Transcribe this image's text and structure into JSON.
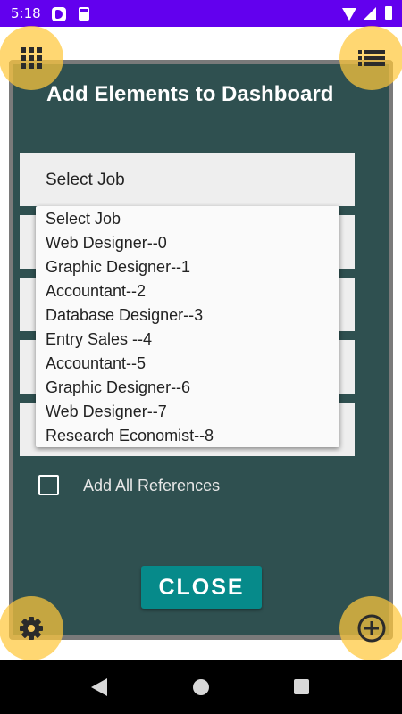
{
  "status_bar": {
    "time": "5:18",
    "icons": [
      "app-notification-icon",
      "sd-card-icon",
      "wifi-icon",
      "cell-signal-icon",
      "battery-icon"
    ]
  },
  "dialog": {
    "title": "Add Elements to Dashboard",
    "select_rows": [
      {
        "value": "Select Job"
      },
      {
        "value": ""
      },
      {
        "value": ""
      },
      {
        "value": ""
      },
      {
        "value": ""
      }
    ],
    "dropdown_options": [
      "Select Job",
      "Web Designer--0",
      "Graphic Designer--1",
      "Accountant--2",
      "Database Designer--3",
      "Entry Sales --4",
      "Accountant--5",
      "Graphic Designer--6",
      "Web Designer--7",
      "Research Economist--8"
    ],
    "checkbox": {
      "label": "Add All References",
      "checked": false
    },
    "close_label": "CLOSE"
  },
  "fabs": {
    "top_left": "grid-icon",
    "top_right": "list-icon",
    "bottom_left": "settings-icon",
    "bottom_right": "add-circle-icon"
  },
  "colors": {
    "status_bar": "#6200ee",
    "panel": "#2f5050",
    "panel_border": "#7a7a7a",
    "fab": "#ffc83c",
    "close_button": "#068a8a"
  }
}
